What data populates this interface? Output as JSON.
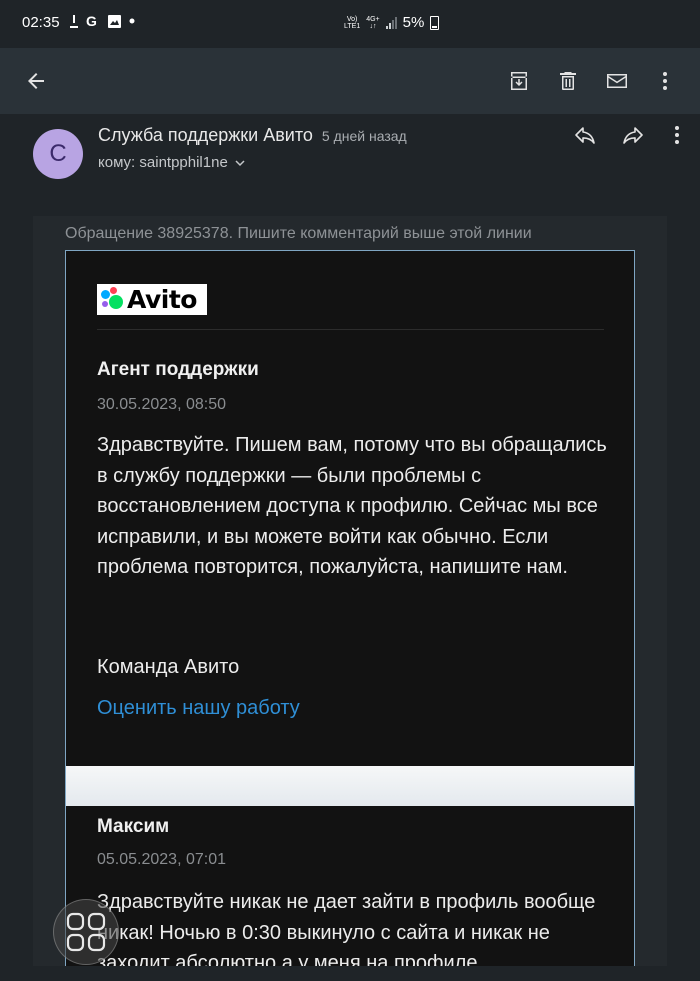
{
  "status_bar": {
    "time": "02:35",
    "network_top": "Vo)",
    "network_bottom": "LTE1",
    "net_type_top": "4G+",
    "net_type_bottom": "↓↑",
    "battery": "5%"
  },
  "sender": {
    "avatar_letter": "C",
    "name": "Служба поддержки Авито",
    "time": "5 дней назад",
    "recipient": "кому: saintpphil1ne"
  },
  "message": {
    "ticket_line": "Обращение 38925378. Пишите комментарий выше этой линии",
    "logo_text": "Avito",
    "agent": "Агент поддержки",
    "agent_date": "30.05.2023, 08:50",
    "body": "Здравствуйте. Пишем вам, потому что вы обращались в службу поддержки — были проблемы с восстановлением доступа к профилю. Сейчас мы все исправили, и вы можете войти как обычно. Если проблема повторится, пожалуйста, напишите нам.",
    "team": "Команда Авито",
    "rate_link": "Оценить нашу работу",
    "reply_author": "Максим",
    "reply_date": "05.05.2023, 07:01",
    "reply_body": "Здравствуйте никак не дает зайти в профиль вообще никак! Ночью в 0:30 выкинуло с сайта и никак не заходит абсолютно а у меня на профиле"
  },
  "colors": {
    "app_bar": "#2a3238",
    "avatar": "#b8a4e3",
    "link": "#2f8fd6"
  }
}
